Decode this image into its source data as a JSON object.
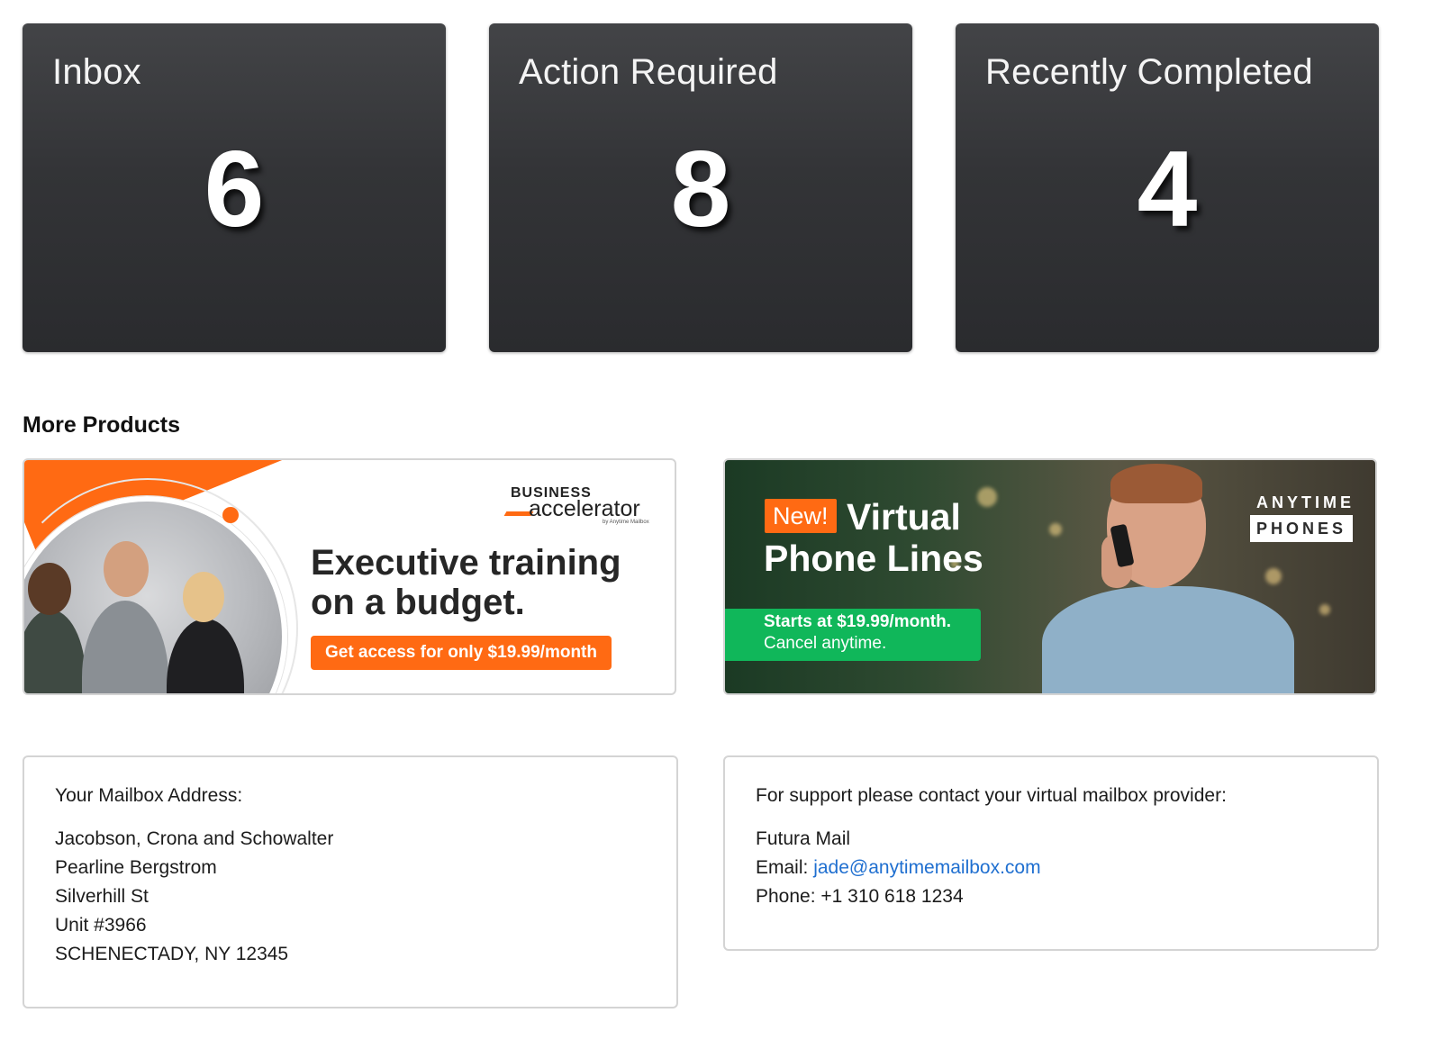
{
  "tiles": [
    {
      "title": "Inbox",
      "count": "6"
    },
    {
      "title": "Action Required",
      "count": "8"
    },
    {
      "title": "Recently Completed",
      "count": "4"
    }
  ],
  "more_products": {
    "heading": "More Products",
    "business_accelerator": {
      "logo_top": "BUSINESS",
      "logo_main": "accelerator",
      "logo_sub": "by Anytime Mailbox",
      "headline_line1": "Executive training",
      "headline_line2": "on a budget.",
      "cta": "Get access for only $19.99/month"
    },
    "virtual_phones": {
      "badge": "New!",
      "headline_line1": "Virtual",
      "headline_line2": "Phone Lines",
      "price_line": "Starts at $19.99/month.",
      "cancel_line": "Cancel anytime.",
      "brand_top": "ANYTIME",
      "brand_bottom": "PHONES"
    }
  },
  "mailbox_address": {
    "label": "Your Mailbox Address:",
    "lines": [
      "Jacobson, Crona and Schowalter",
      "Pearline Bergstrom",
      "Silverhill St",
      "Unit #3966",
      "SCHENECTADY, NY 12345"
    ]
  },
  "support": {
    "label": "For support please contact your virtual mailbox provider:",
    "provider": "Futura Mail",
    "email_prefix": "Email: ",
    "email": "jade@anytimemailbox.com",
    "phone": "Phone: +1 310 618 1234"
  },
  "colors": {
    "tile_bg": "#333437",
    "accent_orange": "#ff6a13",
    "accent_green": "#10b75a",
    "link": "#1f6fd0"
  }
}
